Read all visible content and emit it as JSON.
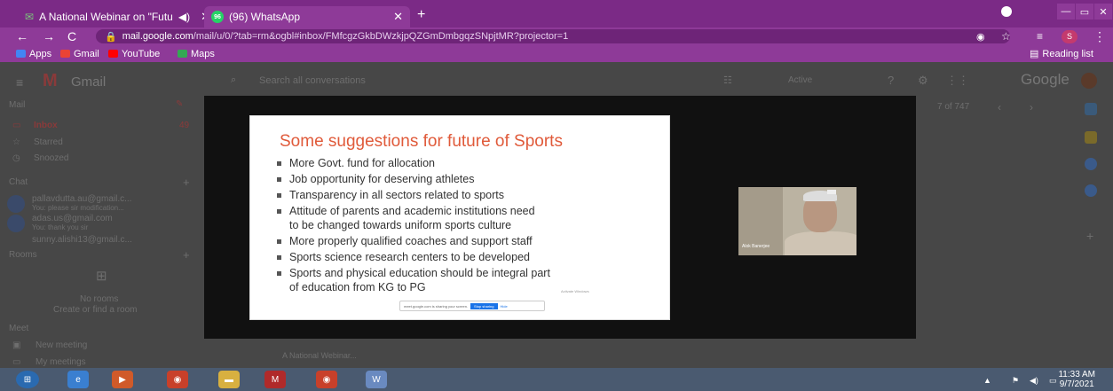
{
  "browser": {
    "tabs": [
      {
        "title": "A National Webinar on \"Futu",
        "active": false
      },
      {
        "title": "(96) WhatsApp",
        "active": true
      }
    ],
    "new_tab": "+",
    "url_host": "mail.google.com",
    "url_path": "/mail/u/0/?tab=rm&ogbl#inbox/FMfcgzGkbDWzkjpQZGmDmbgqzSNpjtMR?projector=1",
    "bookmarks": [
      {
        "label": "Apps",
        "color": "#4285f4"
      },
      {
        "label": "Gmail",
        "color": "#ea4335"
      },
      {
        "label": "YouTube",
        "color": "#ff0000"
      },
      {
        "label": "Maps",
        "color": "#34a853"
      }
    ],
    "reading_list": "Reading list"
  },
  "gmail": {
    "logo": "Gmail",
    "search_placeholder": "Search all conversations",
    "status": "Active",
    "brand": "Google",
    "mail_header": "Mail",
    "folders": [
      {
        "label": "Inbox",
        "count": "49"
      },
      {
        "label": "Starred",
        "count": ""
      },
      {
        "label": "Snoozed",
        "count": ""
      }
    ],
    "chat_header": "Chat",
    "chats": [
      {
        "name": "pallavdutta.au@gmail.c...",
        "preview": "You: please sir modification..."
      },
      {
        "name": "adas.us@gmail.com",
        "preview": "You: thank you sir"
      },
      {
        "name": "sunny.alishi13@gmail.c...",
        "preview": ""
      }
    ],
    "rooms_header": "Rooms",
    "no_rooms": "No rooms",
    "create_room": "Create or find a room",
    "meet_header": "Meet",
    "meet_items": [
      "New meeting",
      "My meetings"
    ],
    "pager": "7 of 747",
    "attachment_label": "A National Webinar..."
  },
  "slide": {
    "title": "Some suggestions for future of  Sports",
    "bullets": [
      [
        "More Govt. fund for allocation"
      ],
      [
        "Job opportunity for deserving athletes"
      ],
      [
        "Transparency in all sectors related to sports"
      ],
      [
        "Attitude of parents and academic institutions need",
        "to be changed towards uniform sports culture"
      ],
      [
        "More properly qualified coaches and support staff"
      ],
      [
        "Sports science research centers to be developed"
      ],
      [
        "Sports and physical education should be integral part",
        "of education  from KG to PG"
      ]
    ],
    "share_text": "meet.google.com is sharing your screen.",
    "share_button": "Stop sharing",
    "hide_button": "Hide",
    "windows_note": "Activate Windows"
  },
  "video": {
    "participant": "Alok Banerjee"
  },
  "taskbar": {
    "time": "11:33 AM",
    "date": "9/7/2021"
  }
}
